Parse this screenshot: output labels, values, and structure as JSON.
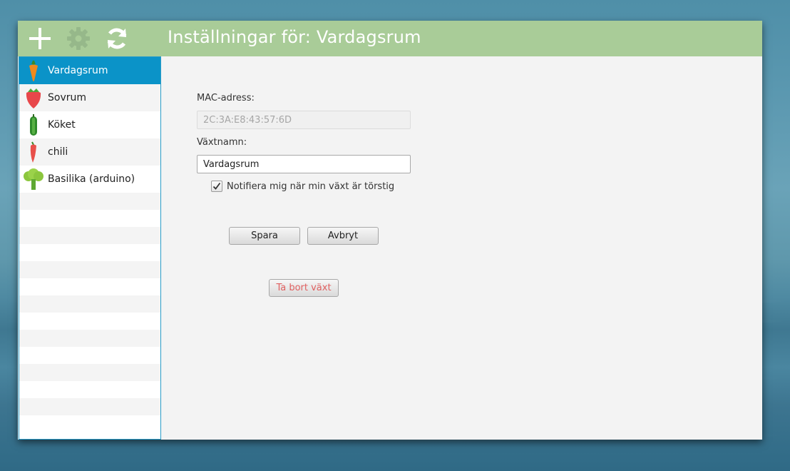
{
  "toolbar": {
    "add_icon": "plus-icon",
    "settings_icon": "gear-icon",
    "refresh_icon": "refresh-icon",
    "title": "Inställningar för: Vardagsrum"
  },
  "sidebar": {
    "items": [
      {
        "label": "Vardagsrum",
        "icon": "carrot-icon",
        "selected": true
      },
      {
        "label": "Sovrum",
        "icon": "strawberry-icon",
        "selected": false
      },
      {
        "label": "Köket",
        "icon": "cucumber-icon",
        "selected": false
      },
      {
        "label": "chili",
        "icon": "chili-icon",
        "selected": false
      },
      {
        "label": "Basilika (arduino)",
        "icon": "broccoli-icon",
        "selected": false
      }
    ]
  },
  "settings": {
    "mac_label": "MAC-adress:",
    "mac_value": "2C:3A:E8:43:57:6D",
    "name_label": "Växtnamn:",
    "name_value": "Vardagsrum",
    "notify_label": "Notifiera mig när min växt är törstig",
    "notify_checked": true,
    "save_label": "Spara",
    "cancel_label": "Avbryt",
    "delete_label": "Ta bort växt"
  },
  "colors": {
    "topbar": "#a9cc98",
    "selection": "#0b93c8",
    "danger_text": "#e06060"
  }
}
